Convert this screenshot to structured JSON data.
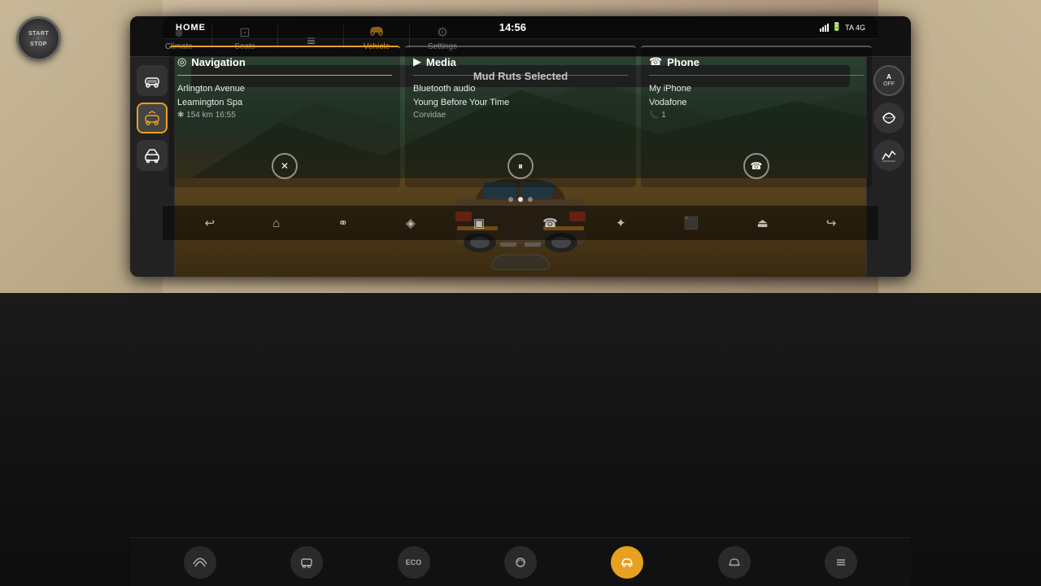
{
  "upper_screen": {
    "status_bar": {
      "home_label": "HOME",
      "time": "14:56",
      "signal": "▌▌▌",
      "battery": "▮",
      "network": "TA 4G"
    },
    "panels": [
      {
        "id": "navigation",
        "title": "Navigation",
        "icon": "◎",
        "active": true,
        "line1": "Arlington Avenue",
        "line2": "Leamington Spa",
        "line3": "✱ 154 km  16:55",
        "button_icon": "✕"
      },
      {
        "id": "media",
        "title": "Media",
        "icon": "▶",
        "active": false,
        "line1": "Bluetooth audio",
        "line2": "Young Before Your Time",
        "line3": "Corvidae",
        "button_icon": "⏸"
      },
      {
        "id": "phone",
        "title": "Phone",
        "icon": "☎",
        "active": false,
        "line1": "My iPhone",
        "line2": "Vodafone",
        "line3": "📞 1",
        "button_icon": "📞"
      }
    ],
    "dots": [
      false,
      true,
      false
    ],
    "toolbar": {
      "icons": [
        "↩",
        "⌂",
        "⚭",
        "◈",
        "🎬",
        "☎",
        "✦",
        "🎥",
        "⏏",
        "↪"
      ]
    }
  },
  "lower_screen": {
    "tabs": [
      {
        "id": "climate",
        "label": "Climate",
        "icon": "❄",
        "active": false
      },
      {
        "id": "seats",
        "label": "Seats",
        "icon": "⊡",
        "active": false
      },
      {
        "id": "drive",
        "label": "",
        "icon": "≡",
        "active": false
      },
      {
        "id": "vehicle",
        "label": "Vehicle",
        "icon": "🚗",
        "active": true
      },
      {
        "id": "settings",
        "label": "Settings",
        "icon": "⚙",
        "active": false
      }
    ],
    "terrain_banner": "Mud Ruts Selected",
    "left_buttons": [
      {
        "icon": "🚙",
        "active": false
      },
      {
        "icon": "🚗",
        "active": true
      },
      {
        "icon": "🚘",
        "active": false
      }
    ],
    "right_buttons": [
      {
        "label": "OFF",
        "sublabel": ""
      },
      {
        "icon": "〰"
      },
      {
        "icon": "⛰"
      }
    ],
    "bottom_icons": [
      {
        "icon": "〜",
        "active": false
      },
      {
        "icon": "🅿",
        "active": false
      },
      {
        "icon": "ECO",
        "active": false,
        "text": "ECO"
      },
      {
        "icon": "❄",
        "active": false
      },
      {
        "icon": "🚗",
        "active": true
      },
      {
        "icon": "🚘",
        "active": false
      },
      {
        "icon": "≡",
        "active": false
      }
    ]
  },
  "start_stop": {
    "line1": "START",
    "line2": "STOP"
  }
}
